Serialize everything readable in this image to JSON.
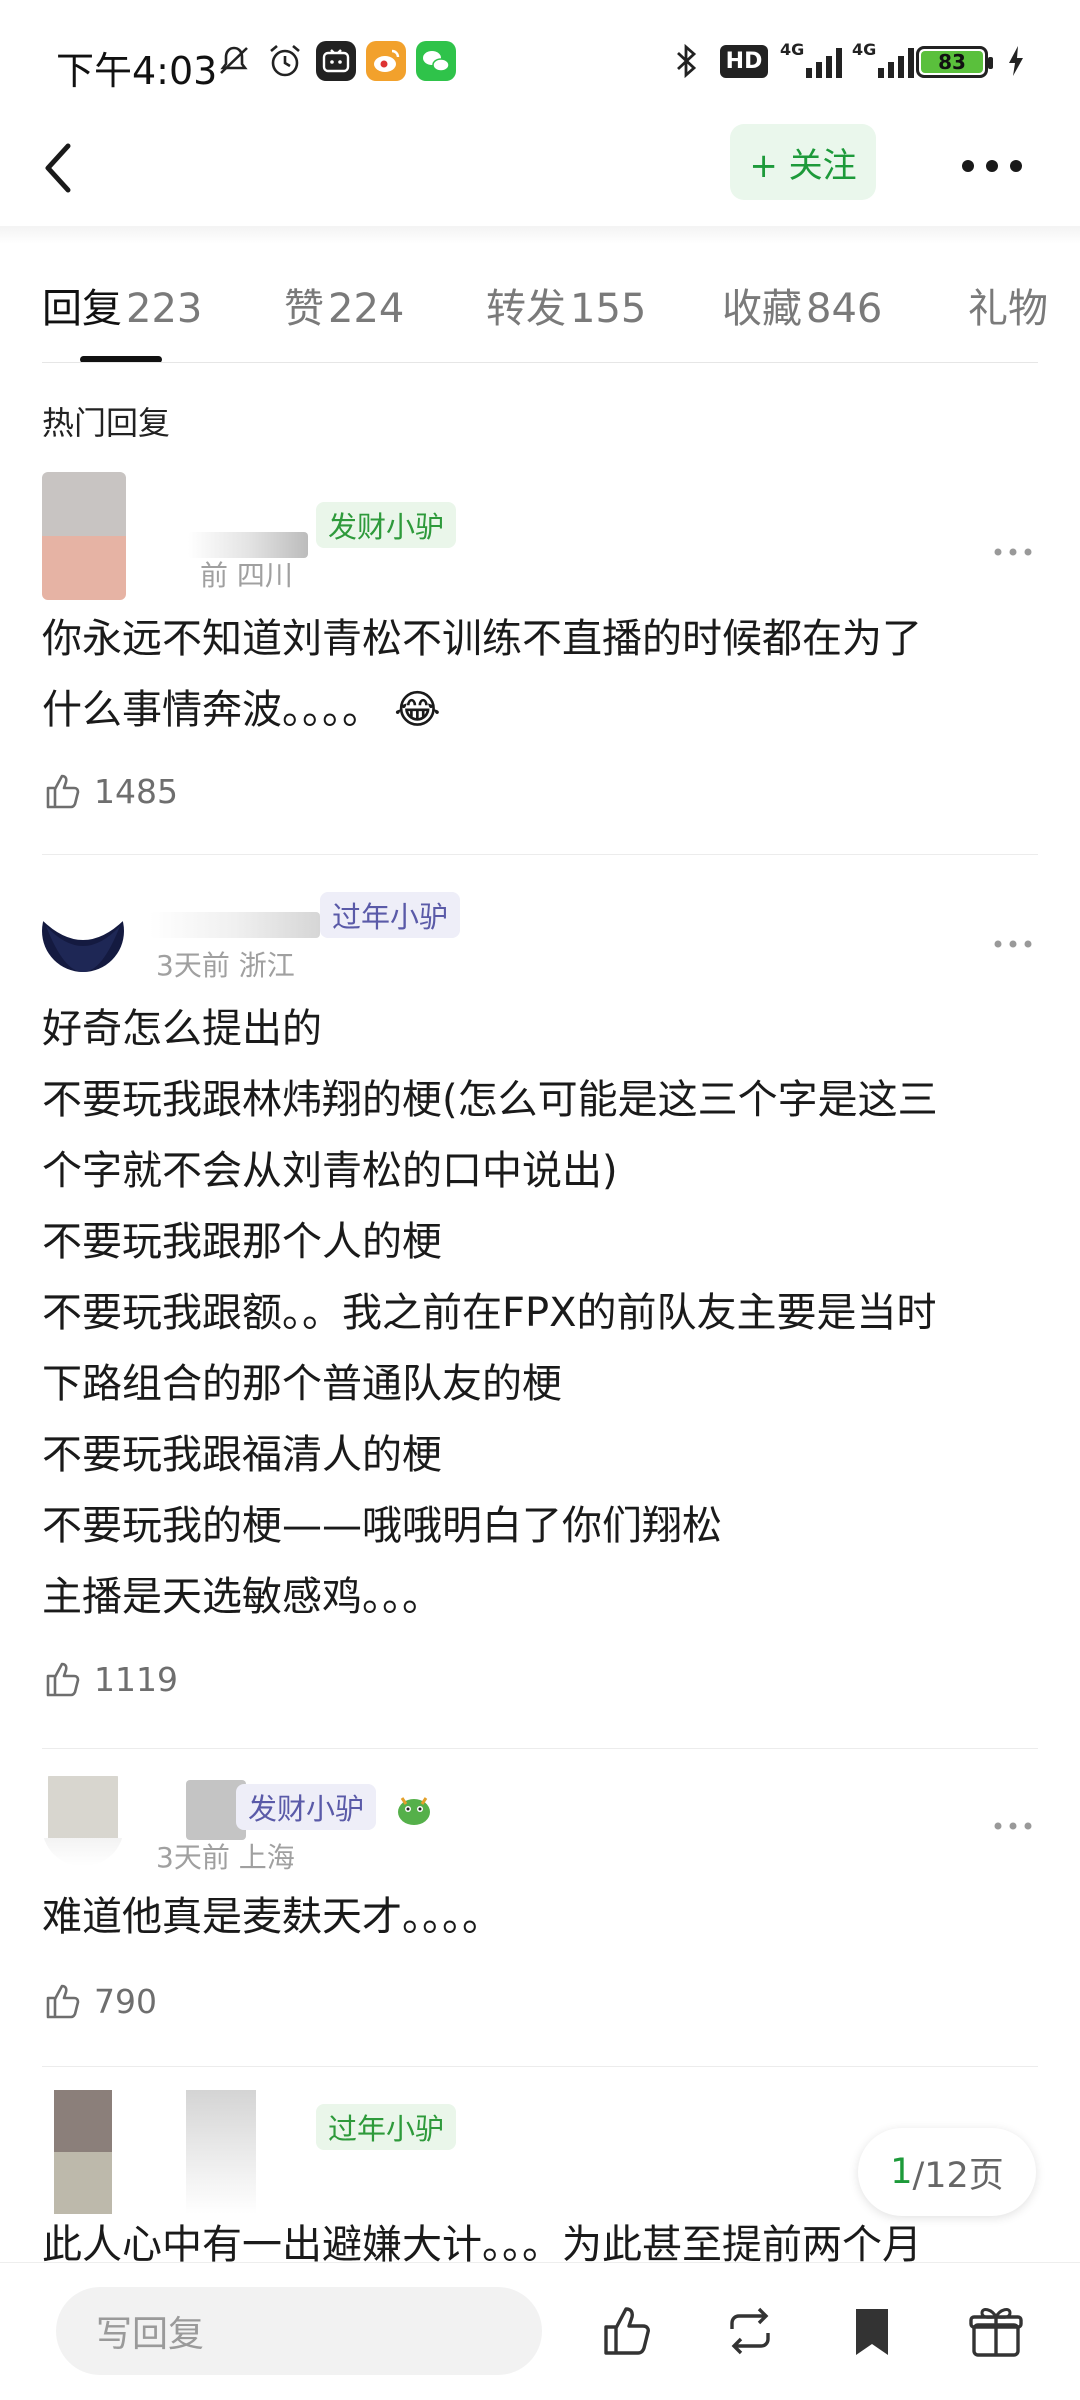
{
  "status_bar": {
    "time": "下午4:03",
    "battery": "83",
    "network": [
      "4G",
      "4G"
    ],
    "hd_label": "HD",
    "icons": [
      "mute-icon",
      "alarm-icon",
      "bilibili-app-icon",
      "weibo-app-icon",
      "wechat-app-icon",
      "bluetooth-icon",
      "hd-voice-icon",
      "signal-icon",
      "battery-icon",
      "charging-icon"
    ]
  },
  "header": {
    "follow_label": "+ 关注"
  },
  "tabs": [
    {
      "label": "回复",
      "count": "223"
    },
    {
      "label": "赞",
      "count": "224"
    },
    {
      "label": "转发",
      "count": "155"
    },
    {
      "label": "收藏",
      "count": "846"
    },
    {
      "label": "礼物",
      "count": ""
    }
  ],
  "section_title": "热门回复",
  "comments": [
    {
      "badge": "发财小驴",
      "meta": "前 四川",
      "lines": [
        "你永远不知道刘青松不训练不直播的时候都在为了",
        "什么事情奔波。。。。"
      ],
      "emoji": "😂",
      "likes": "1485"
    },
    {
      "badge": "过年小驴",
      "meta": "3天前 浙江",
      "lines": [
        "好奇怎么提出的",
        "不要玩我跟林炜翔的梗(怎么可能是这三个字是这三",
        "个字就不会从刘青松的口中说出)",
        "不要玩我跟那个人的梗",
        "不要玩我跟额。。我之前在FPX的前队友主要是当时",
        "下路组合的那个普通队友的梗",
        "不要玩我跟福清人的梗",
        "不要玩我的梗——哦哦明白了你们翔松",
        "主播是天选敏感鸡。。。"
      ],
      "likes": "1119"
    },
    {
      "badge": "发财小驴",
      "meta": "3天前 上海",
      "lines": [
        "难道他真是麦麸天才。。。。"
      ],
      "likes": "790"
    },
    {
      "badge": "过年小驴",
      "meta": "",
      "lines": [
        "此人心中有一出避嫌大计。。。为此甚至提前两个月"
      ],
      "likes": ""
    }
  ],
  "pager": {
    "current": "1",
    "total": "/12页"
  },
  "bottom_bar": {
    "reply_placeholder": "写回复",
    "icons": [
      "like-icon",
      "repost-icon",
      "bookmark-icon",
      "gift-icon"
    ]
  },
  "colors": {
    "accent_green": "#1d9a3a",
    "badge_green_bg": "#eaf6ea",
    "badge_purple_bg": "#eeeef8",
    "badge_purple_text": "#5a5aa8"
  }
}
